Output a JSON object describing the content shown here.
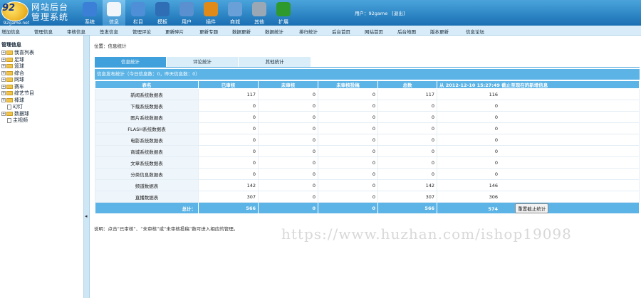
{
  "header": {
    "logo_num": "92",
    "logo_site": "92game.net",
    "title_line1": "网站后台",
    "title_line2": "管理系统",
    "user_text": "用户：92game",
    "exit_text": "[退出]",
    "nav": [
      {
        "label": "系统",
        "icon": "globe-icon",
        "color": "#3b7fd6"
      },
      {
        "label": "信息",
        "icon": "document-edit-icon",
        "color": "#f2f6fa"
      },
      {
        "label": "栏目",
        "icon": "folder-icon",
        "color": "#4e8fd8"
      },
      {
        "label": "模板",
        "icon": "template-icon",
        "color": "#2f6db5"
      },
      {
        "label": "用户",
        "icon": "user-icon",
        "color": "#5a8fd0"
      },
      {
        "label": "插件",
        "icon": "tools-icon",
        "color": "#e08a1a"
      },
      {
        "label": "商城",
        "icon": "shop-icon",
        "color": "#6aa0d8"
      },
      {
        "label": "其他",
        "icon": "gear-icon",
        "color": "#9aa7b5"
      },
      {
        "label": "扩展",
        "icon": "plus-icon",
        "color": "#2e9a2e"
      }
    ]
  },
  "submenu": [
    "增加信息",
    "管理信息",
    "审核信息",
    "签发信息",
    "管理评论",
    "更新碎片",
    "更新专题",
    "数据更新",
    "数据统计",
    "排行统计",
    "后台首页",
    "网站首页",
    "后台地图",
    "版本更新",
    "信息论坛"
  ],
  "sidebar": {
    "title": "管理信息",
    "items": [
      {
        "label": "我喜列表",
        "type": "folder"
      },
      {
        "label": "足球",
        "type": "folder"
      },
      {
        "label": "篮球",
        "type": "folder"
      },
      {
        "label": "综合",
        "type": "folder"
      },
      {
        "label": "网球",
        "type": "folder"
      },
      {
        "label": "赛车",
        "type": "folder"
      },
      {
        "label": "综艺节目",
        "type": "folder"
      },
      {
        "label": "棒球",
        "type": "folder"
      },
      {
        "label": "幻灯",
        "type": "doc"
      },
      {
        "label": "数据球",
        "type": "folder"
      },
      {
        "label": "主视频",
        "type": "doc"
      }
    ]
  },
  "main": {
    "breadcrumb": "位置：信息统计",
    "tabs": [
      "信息统计",
      "评论统计",
      "其他统计"
    ],
    "summary": "信息发布统计（今日信息数：0，昨天信息数：0）",
    "columns": [
      "表名",
      "已审核",
      "未审核",
      "未审核投稿",
      "总数",
      "从 2012-12-10 15:27:49 截止至现在的新增信息"
    ],
    "rows": [
      {
        "name": "新闻系统数据表",
        "a": "117",
        "b": "0",
        "c": "0",
        "d": "117",
        "e": "116"
      },
      {
        "name": "下载系统数据表",
        "a": "0",
        "b": "0",
        "c": "0",
        "d": "0",
        "e": "0"
      },
      {
        "name": "图片系统数据表",
        "a": "0",
        "b": "0",
        "c": "0",
        "d": "0",
        "e": "0"
      },
      {
        "name": "FLASH系统数据表",
        "a": "0",
        "b": "0",
        "c": "0",
        "d": "0",
        "e": "0"
      },
      {
        "name": "电影系统数据表",
        "a": "0",
        "b": "0",
        "c": "0",
        "d": "0",
        "e": "0"
      },
      {
        "name": "商城系统数据表",
        "a": "0",
        "b": "0",
        "c": "0",
        "d": "0",
        "e": "0"
      },
      {
        "name": "文章系统数据表",
        "a": "0",
        "b": "0",
        "c": "0",
        "d": "0",
        "e": "0"
      },
      {
        "name": "分类信息数据表",
        "a": "0",
        "b": "0",
        "c": "0",
        "d": "0",
        "e": "0"
      },
      {
        "name": "频道数据表",
        "a": "142",
        "b": "0",
        "c": "0",
        "d": "142",
        "e": "146"
      },
      {
        "name": "直播数据表",
        "a": "307",
        "b": "0",
        "c": "0",
        "d": "307",
        "e": "306"
      }
    ],
    "total": {
      "label": "总计：",
      "a": "566",
      "b": "0",
      "c": "0",
      "d": "566",
      "e": "574",
      "button": "重置截止统计"
    },
    "note": "说明：点击“已审核”、“未审核”或“未审核投稿”数可进入相应的管理。"
  },
  "watermark": "https://www.huzhan.com/ishop19098"
}
